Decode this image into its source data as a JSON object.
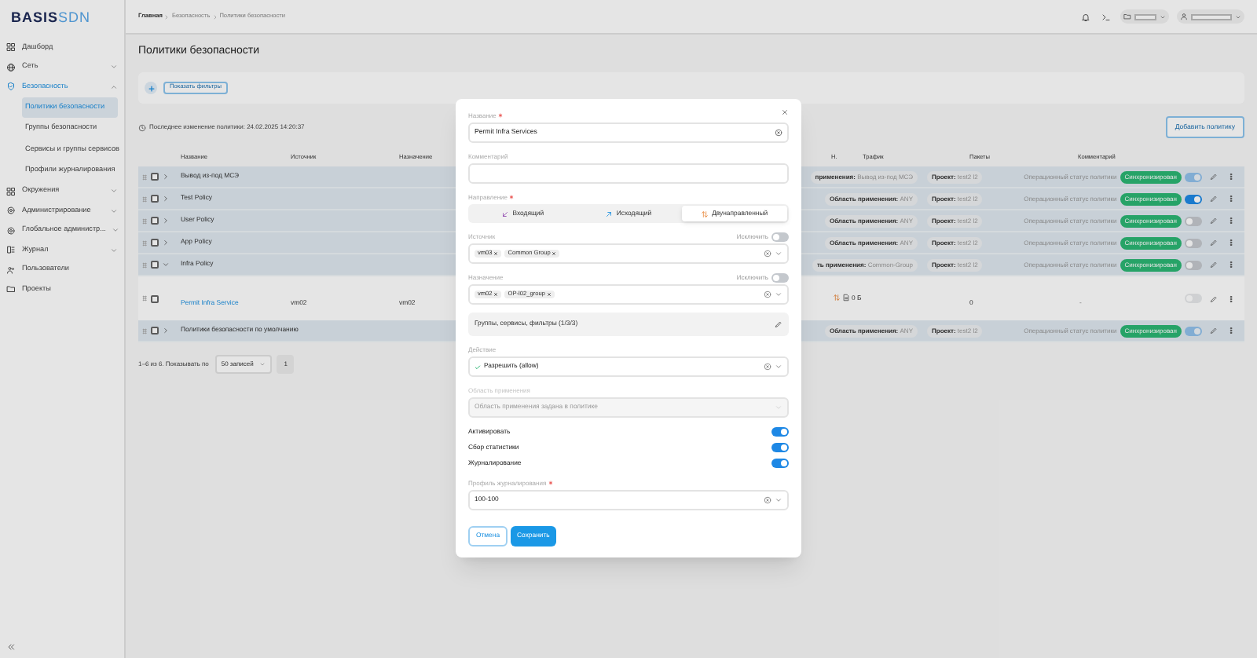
{
  "sidebar": {
    "logo": {
      "text": "BASIS",
      "accent": "SDN"
    },
    "items": [
      {
        "label": "Дашборд",
        "kind": "link",
        "selected": false
      },
      {
        "label": "Сеть",
        "kind": "group",
        "expanded": false,
        "selected": false
      },
      {
        "label": "Безопасность",
        "kind": "group",
        "expanded": true,
        "selected": true,
        "children": [
          {
            "label": "Политики безопасности",
            "selected": true
          },
          {
            "label": "Группы безопасности",
            "selected": false
          },
          {
            "label": "Сервисы и группы сервисов",
            "selected": false
          },
          {
            "label": "Профили журналирования",
            "selected": false
          }
        ]
      },
      {
        "label": "Окружения",
        "kind": "group",
        "expanded": false,
        "selected": false
      },
      {
        "label": "Администрирование",
        "kind": "group",
        "expanded": false,
        "selected": false
      },
      {
        "label": "Глобальное администр...",
        "kind": "group",
        "expanded": false,
        "selected": false
      },
      {
        "label": "Журнал",
        "kind": "group",
        "expanded": false,
        "selected": false
      },
      {
        "label": "Пользователи",
        "kind": "link",
        "selected": false
      },
      {
        "label": "Проекты",
        "kind": "link",
        "selected": false
      }
    ]
  },
  "header": {
    "breadcrumbs": [
      "Главная",
      "Безопасность",
      "Политики безопасности"
    ]
  },
  "page": {
    "title": "Политики безопасности",
    "filters_button": "Показать фильтры",
    "last_change": "Последнее изменение политики: 24.02.2025 14:20:37",
    "add_button": "Добавить политику"
  },
  "table": {
    "columns_left": [
      "Название",
      "Источник",
      "Назначение"
    ],
    "columns_right": [
      "Н.",
      "Трафик",
      "Пакеты",
      "Комментарий"
    ],
    "rows": [
      {
        "name": "Вывод из-под МСЭ",
        "checked": false,
        "expanded": false,
        "scope_label": "применения:",
        "scope_value": "Вывод из-под МСЭ",
        "project_label": "Проект:",
        "project_value": "test2 l2",
        "status_label": "Операционный статус политики",
        "status_badge": "Синхронизирован",
        "on": true,
        "disabled": true
      },
      {
        "name": "Test Policy",
        "checked": false,
        "expanded": false,
        "scope_label": "Область применения:",
        "scope_value": "ANY",
        "project_label": "Проект:",
        "project_value": "test2 l2",
        "status_label": "Операционный статус политики",
        "status_badge": "Синхронизирован",
        "on": true,
        "disabled": false
      },
      {
        "name": "User Policy",
        "checked": false,
        "expanded": false,
        "scope_label": "Область применения:",
        "scope_value": "ANY",
        "project_label": "Проект:",
        "project_value": "test2 l2",
        "status_label": "Операционный статус политики",
        "status_badge": "Синхронизирован",
        "on": false,
        "disabled": false
      },
      {
        "name": "App Policy",
        "checked": false,
        "expanded": false,
        "scope_label": "Область применения:",
        "scope_value": "ANY",
        "project_label": "Проект:",
        "project_value": "test2 l2",
        "status_label": "Операционный статус политики",
        "status_badge": "Синхронизирован",
        "on": false,
        "disabled": false
      },
      {
        "name": "Infra Policy",
        "checked": false,
        "expanded": true,
        "scope_label": "ть применения:",
        "scope_value": "Common-Group",
        "project_label": "Проект:",
        "project_value": "test2 l2",
        "status_label": "Операционный статус политики",
        "status_badge": "Синхронизирован",
        "on": false,
        "disabled": false,
        "children": [
          {
            "name": "Permit Infra Service",
            "checked": false,
            "source": "vm02",
            "destination": "vm02",
            "traffic": "0 Б",
            "packets": "0",
            "comment": "-",
            "on": false,
            "disabled": true
          }
        ]
      },
      {
        "name": "Политики безопасности по умолчанию",
        "checked": false,
        "expanded": false,
        "scope_label": "Область применения:",
        "scope_value": "ANY",
        "project_label": "Проект:",
        "project_value": "test2 l2",
        "status_label": "Операционный статус политики",
        "status_badge": "Синхронизирован",
        "on": true,
        "disabled": true
      }
    ]
  },
  "pagination": {
    "summary": "1–6 из 6. Показывать по",
    "page_size": "50 записей",
    "pages": [
      {
        "label": "1",
        "selected": true
      }
    ]
  },
  "modal": {
    "name": {
      "label": "Название",
      "required": true,
      "value": "Permit Infra Services"
    },
    "comment": {
      "label": "Комментарий"
    },
    "direction": {
      "label": "Направление",
      "required": true,
      "options": [
        {
          "label": "Входящий",
          "selected": false
        },
        {
          "label": "Исходящий",
          "selected": false
        },
        {
          "label": "Двунаправленный",
          "selected": true
        }
      ]
    },
    "source": {
      "label": "Источник",
      "exclude_label": "Исключить",
      "exclude": false,
      "chips": [
        "vm03",
        "Common Group"
      ]
    },
    "destination": {
      "label": "Назначение",
      "exclude_label": "Исключить",
      "exclude": false,
      "chips": [
        "vm02",
        "OP-l02_group"
      ]
    },
    "services": {
      "text": "Группы, сервисы, фильтры (1/3/3)"
    },
    "action": {
      "label": "Действие",
      "value": "Разрешить (allow)"
    },
    "scope": {
      "label": "Область применения",
      "placeholder": "Область применения задана в политике",
      "disabled": true
    },
    "switches": [
      {
        "label": "Активировать",
        "on": true
      },
      {
        "label": "Сбор статистики",
        "on": true
      },
      {
        "label": "Журналирование",
        "on": true
      }
    ],
    "log_profile": {
      "label": "Профиль журналирования",
      "required": true,
      "value": "100-100"
    },
    "buttons": {
      "cancel": "Отмена",
      "save": "Сохранить"
    }
  }
}
